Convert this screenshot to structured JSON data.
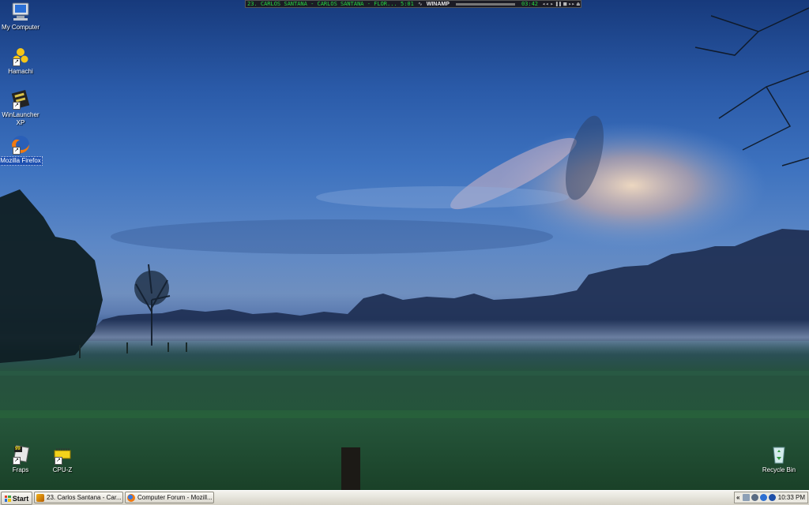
{
  "desktop": {
    "icons_left": [
      {
        "label": "My Computer",
        "icon": "my-computer-icon"
      },
      {
        "label": "Hamachi",
        "icon": "hamachi-icon"
      },
      {
        "label": "WinLauncher XP",
        "icon": "winlauncher-icon"
      },
      {
        "label": "Mozilla Firefox",
        "icon": "firefox-icon"
      }
    ],
    "icons_bottom": [
      {
        "label": "Fraps",
        "icon": "fraps-icon",
        "badge": "99"
      },
      {
        "label": "CPU-Z",
        "icon": "cpuz-icon"
      },
      {
        "label": "Recycle Bin",
        "icon": "recycle-bin-icon"
      }
    ]
  },
  "winamp": {
    "track": "23. CARLOS SANTANA - CARLOS SANTANA - FLOR...",
    "duration": "5:01",
    "brand": "WINAMP",
    "elapsed": "03:42"
  },
  "taskbar": {
    "start_label": "Start",
    "tasks": [
      {
        "label": "23. Carlos Santana - Car...",
        "icon": "winamp-icon"
      },
      {
        "label": "Computer Forum - Mozill...",
        "icon": "firefox-icon"
      }
    ],
    "tray_expand": "«",
    "clock": "10:33 PM"
  },
  "colors": {
    "accent": "#1c4fb0",
    "winamp_text": "#25d641"
  }
}
